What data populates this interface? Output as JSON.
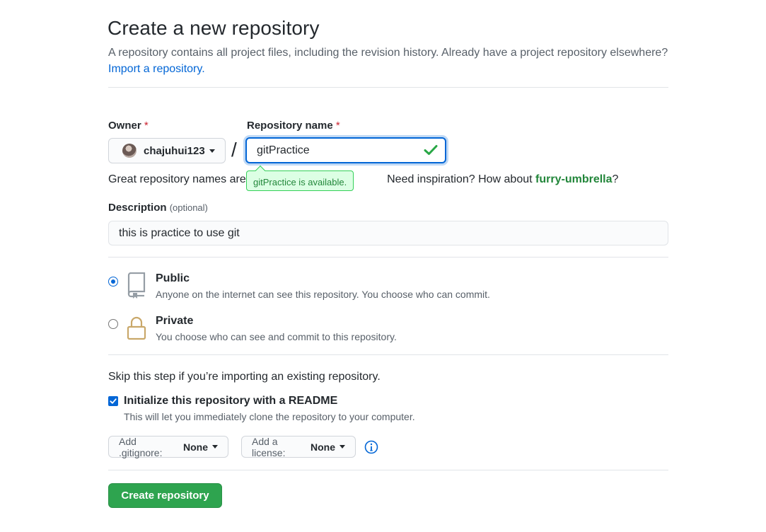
{
  "header": {
    "title": "Create a new repository",
    "subtitle": "A repository contains all project files, including the revision history. Already have a project repository elsewhere?",
    "import_link": "Import a repository."
  },
  "owner": {
    "label": "Owner",
    "required_mark": "*",
    "value": "chajuhui123"
  },
  "repo_name": {
    "label": "Repository name",
    "required_mark": "*",
    "value": "gitPractice",
    "available_tooltip": "gitPractice is available.",
    "slash": "/"
  },
  "hint": {
    "prefix": "Great repository names are s",
    "inspiration": "Need inspiration? How about",
    "suggestion": "furry-umbrella",
    "suffix": "?"
  },
  "description": {
    "label": "Description",
    "optional": "(optional)",
    "value": "this is practice to use git"
  },
  "visibility": {
    "public_title": "Public",
    "public_desc": "Anyone on the internet can see this repository. You choose who can commit.",
    "private_title": "Private",
    "private_desc": "You choose who can see and commit to this repository.",
    "selected": "public"
  },
  "init": {
    "skip_text": "Skip this step if you’re importing an existing repository.",
    "readme_label": "Initialize this repository with a README",
    "readme_desc": "This will let you immediately clone the repository to your computer.",
    "readme_checked": true
  },
  "dropdowns": {
    "gitignore_label": "Add .gitignore:",
    "gitignore_value": "None",
    "license_label": "Add a license:",
    "license_value": "None"
  },
  "submit": {
    "label": "Create repository"
  },
  "colors": {
    "accent": "#0366d6",
    "success": "#2ea44f",
    "suggestion": "#22863a"
  }
}
